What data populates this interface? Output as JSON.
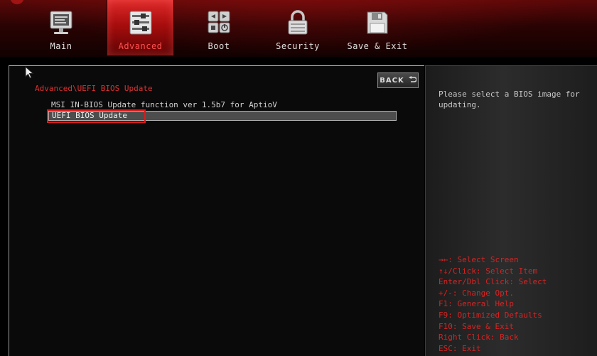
{
  "nav": {
    "tabs": [
      {
        "label": "Main",
        "icon": "monitor-icon"
      },
      {
        "label": "Advanced",
        "icon": "sliders-icon",
        "active": true
      },
      {
        "label": "Boot",
        "icon": "boot-grid-icon"
      },
      {
        "label": "Security",
        "icon": "lock-icon"
      },
      {
        "label": "Save & Exit",
        "icon": "floppy-disk-icon"
      }
    ]
  },
  "main": {
    "breadcrumb": "Advanced\\UEFI BIOS Update",
    "items": [
      {
        "label": "MSI IN-BIOS Update function ver 1.5b7 for AptioV"
      },
      {
        "label": "UEFI BIOS Update",
        "selected": true
      }
    ],
    "back_button": "BACK"
  },
  "help": {
    "text": "Please select a BIOS image for updating.",
    "keys": [
      "→←: Select Screen",
      "↑↓/Click: Select Item",
      "Enter/Dbl Click: Select",
      "+/-: Change Opt.",
      "F1: General Help",
      "F9: Optimized Defaults",
      "F10: Save & Exit",
      "Right Click: Back",
      "ESC: Exit"
    ]
  },
  "colors": {
    "accent": "#e03030",
    "active_tab": "#c41818",
    "text": "#d2d2d2",
    "background": "#000000"
  }
}
